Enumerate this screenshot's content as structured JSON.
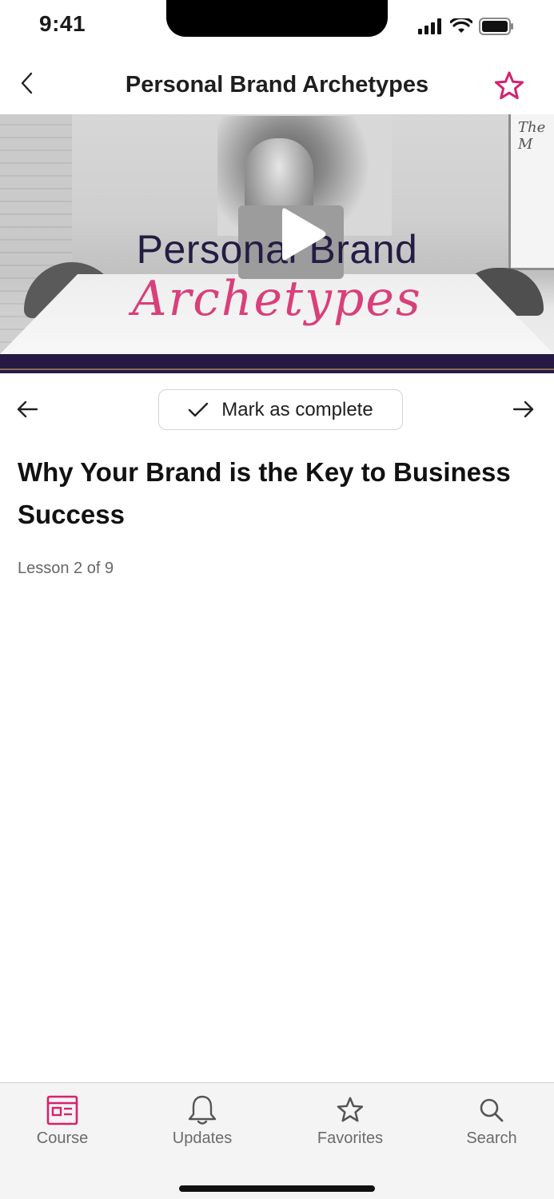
{
  "status_bar": {
    "time": "9:41"
  },
  "header": {
    "title": "Personal Brand Archetypes"
  },
  "video": {
    "title_line1": "Personal Brand",
    "title_line2": "Archetypes",
    "whiteboard_text": "The M"
  },
  "lesson_nav": {
    "complete_label": "Mark as complete"
  },
  "lesson": {
    "title": "Why Your Brand is the Key to Business Success",
    "count": "Lesson 2 of 9"
  },
  "tabs": [
    {
      "label": "Course",
      "icon": "course-icon",
      "active": true
    },
    {
      "label": "Updates",
      "icon": "bell-icon",
      "active": false
    },
    {
      "label": "Favorites",
      "icon": "star-icon",
      "active": false
    },
    {
      "label": "Search",
      "icon": "search-icon",
      "active": false
    }
  ],
  "colors": {
    "accent": "#d6226e",
    "band": "#261a45",
    "tab_label": "#6b6b6b"
  }
}
